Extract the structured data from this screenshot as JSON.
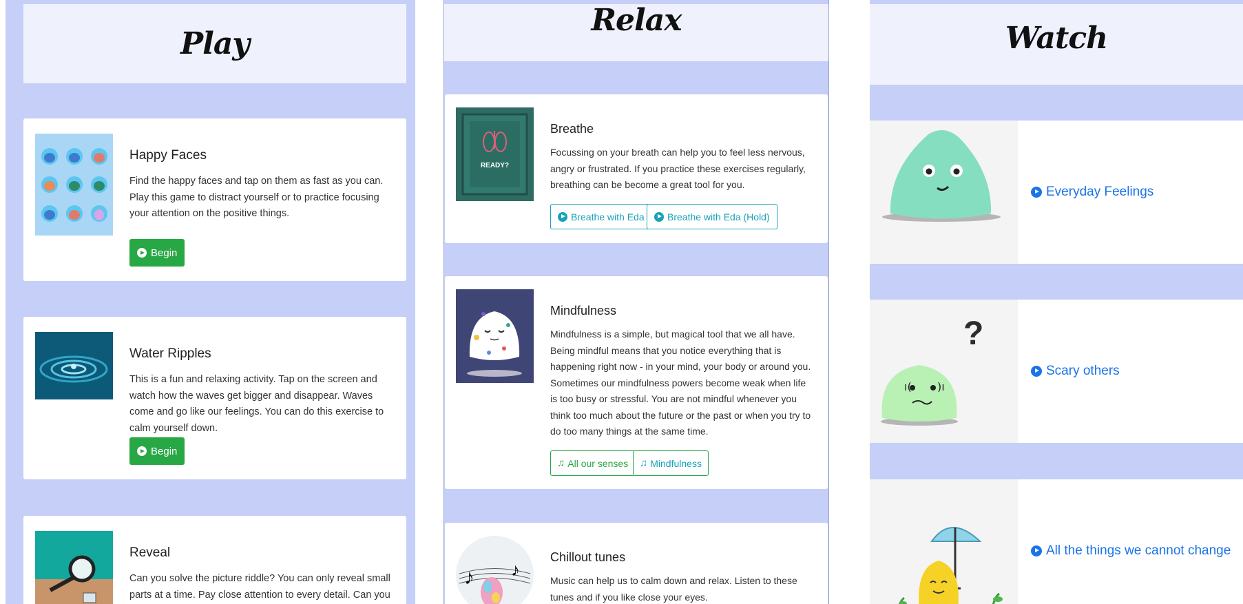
{
  "play": {
    "title": "Play",
    "cards": [
      {
        "title": "Happy Faces",
        "description": "Find the happy faces and tap on them as fast as you can. Play this game to distract yourself or to practice focusing your attention on the positive things.",
        "button": "Begin"
      },
      {
        "title": "Water Ripples",
        "description": "This is a fun and relaxing activity. Tap on the screen and watch how the waves get bigger and disappear. Waves come and go like our feelings. You can do this exercise to calm yourself down.",
        "button": "Begin"
      },
      {
        "title": "Reveal",
        "description": "Can you solve the picture riddle? You can only reveal small parts at a time. Pay close attention to every detail. Can you imagine the"
      }
    ]
  },
  "relax": {
    "title": "Relax",
    "cards": [
      {
        "title": "Breathe",
        "description": "Focussing on your breath can help you to feel less nervous, angry or frustrated. If you practice these exercises regularly, breathing can be become a great tool for you.",
        "thumb_text": "READY?",
        "buttons": [
          "Breathe with Eda",
          "Breathe with Eda (Hold)"
        ]
      },
      {
        "title": "Mindfulness",
        "description": "Mindfulness is a simple, but magical tool that we all have. Being mindful means that you notice everything that is happening right now - in your mind, your body or around you. Sometimes our mindfulness powers become weak when life is too busy or stressful. You are not mindful whenever you think too much about the future or the past or when you try to do too many things at the same time.",
        "buttons": [
          "All our senses",
          "Mindfulness"
        ]
      },
      {
        "title": "Chillout tunes",
        "description": "Music can help us to calm down and relax. Listen to these tunes and if you like close your eyes."
      }
    ]
  },
  "watch": {
    "title": "Watch",
    "items": [
      {
        "label": "Everyday Feelings"
      },
      {
        "label": "Scary others",
        "thumb_symbol": "?"
      },
      {
        "label": "All the things we cannot change"
      }
    ]
  },
  "icons": {
    "play": "play-circle-icon",
    "music": "music-note-icon"
  },
  "colors": {
    "page_background": "#c5cff7",
    "header_background": "#eff2fd",
    "success": "#28a745",
    "info": "#17a2b8",
    "link": "#1a73e8"
  }
}
